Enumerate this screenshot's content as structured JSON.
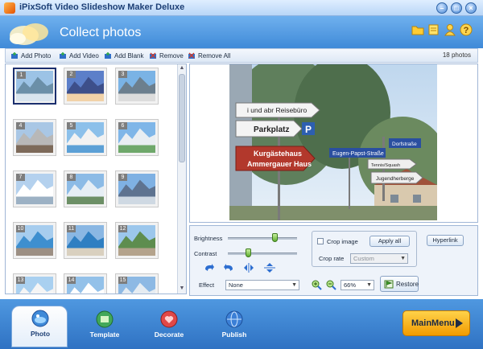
{
  "window": {
    "title": "iPixSoft Video Slideshow Maker Deluxe",
    "controls": [
      "minimize-icon",
      "maximize-icon",
      "close-icon"
    ]
  },
  "header": {
    "title": "Collect photos",
    "icons": [
      "folder-icon",
      "note-icon",
      "user-icon",
      "help-icon"
    ]
  },
  "toolbar": {
    "add_photo": "Add Photo",
    "add_video": "Add Video",
    "add_blank": "Add Blank",
    "remove": "Remove",
    "remove_all": "Remove All",
    "photo_count": "18 photos"
  },
  "thumbnails": [
    {
      "number": "1",
      "selected": true
    },
    {
      "number": "2"
    },
    {
      "number": "3"
    },
    {
      "number": "4"
    },
    {
      "number": "5"
    },
    {
      "number": "6"
    },
    {
      "number": "7"
    },
    {
      "number": "8"
    },
    {
      "number": "9"
    },
    {
      "number": "10"
    },
    {
      "number": "11"
    },
    {
      "number": "12"
    },
    {
      "number": "13"
    },
    {
      "number": "14"
    },
    {
      "number": "15"
    }
  ],
  "preview": {
    "sign_labels": [
      "i und abr Reisebüro",
      "Parkplatz",
      "P",
      "Kurgästehaus",
      "Ammergauer Haus",
      "Eugen-Papst-Straße",
      "Dorfstraße",
      "Tennis/Squash",
      "Jugendherberge"
    ]
  },
  "controls": {
    "brightness_label": "Brightness",
    "brightness_value": 0.68,
    "contrast_label": "Contrast",
    "contrast_value": 0.29,
    "effect_label": "Effect",
    "effect_value": "None",
    "crop_image_label": "Crop image",
    "crop_image_checked": false,
    "apply_all": "Apply all",
    "crop_rate_label": "Crop rate",
    "crop_rate_value": "Custom",
    "hyperlink": "Hyperlink",
    "zoom_value": "66%",
    "restore": "Restore",
    "rotate_buttons": [
      "rotate-left-icon",
      "rotate-right-icon",
      "flip-horizontal-icon",
      "flip-vertical-icon"
    ]
  },
  "bottom_nav": {
    "tabs": [
      {
        "label": "Photo",
        "active": true
      },
      {
        "label": "Template"
      },
      {
        "label": "Decorate"
      },
      {
        "label": "Publish"
      }
    ],
    "main_menu": "MainMenu"
  }
}
